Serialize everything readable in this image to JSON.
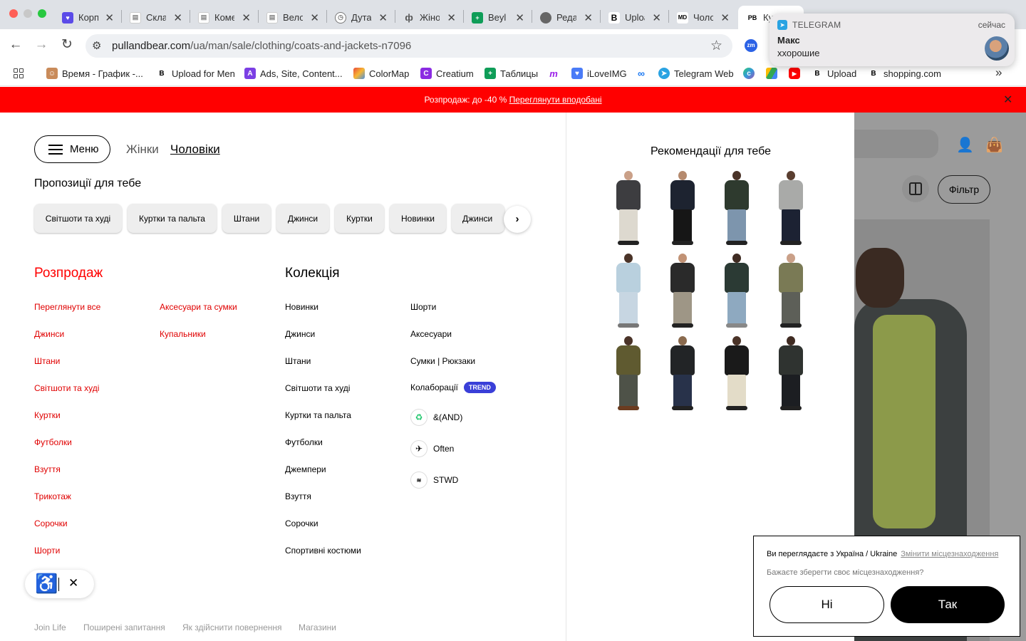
{
  "browser": {
    "tabs": [
      {
        "title": "Корпоративний",
        "fav": "heart-icon",
        "color": "#5b4be8"
      },
      {
        "title": "Склад",
        "fav": "doc-icon",
        "color": "#ffffff"
      },
      {
        "title": "Комерція",
        "fav": "doc-icon",
        "color": "#ffffff"
      },
      {
        "title": "Велосипед",
        "fav": "doc-icon",
        "color": "#ffffff"
      },
      {
        "title": "Дутая куртка",
        "fav": "clock-icon",
        "color": "#ffffff"
      },
      {
        "title": "Жіночий",
        "fav": "tuning-fork-icon",
        "color": "#ffffff"
      },
      {
        "title": "Beyl",
        "fav": "sheets-icon",
        "color": "#0f9d58"
      },
      {
        "title": "Редактор",
        "fav": "globe-icon",
        "color": "#ffffff"
      },
      {
        "title": "Upload",
        "fav": "b-icon",
        "color": "#ffffff"
      },
      {
        "title": "Чоловіки",
        "fav": "md-icon",
        "color": "#ffffff"
      },
      {
        "title": "Куртки",
        "fav": "pb-icon",
        "color": "#ffffff"
      }
    ],
    "url_host": "pullandbear.com",
    "url_path": "/ua/man/sale/clothing/coats-and-jackets-n7096",
    "bookmarks": [
      {
        "label": "Время - График -...",
        "color": "#c98b5a"
      },
      {
        "label": "Upload for Men",
        "color": "#000000"
      },
      {
        "label": "Ads, Site, Content...",
        "color": "#7b3fe4"
      },
      {
        "label": "ColorMap",
        "color": "#e8493b"
      },
      {
        "label": "Creatium",
        "color": "#8b2be2"
      },
      {
        "label": "Таблицы",
        "color": "#0f9d58"
      },
      {
        "label": "iLoveIMG",
        "color": "#4a7bf7"
      },
      {
        "label": "Telegram Web",
        "color": "#2aa3e2"
      },
      {
        "label": "Upload",
        "color": "#000000"
      },
      {
        "label": "shopping.com",
        "color": "#000000"
      }
    ]
  },
  "notification": {
    "app": "TELEGRAM",
    "time": "сейчас",
    "sender": "Макс",
    "message": "ххорошие"
  },
  "promo": {
    "text": "Розпродаж: до -40 % ",
    "link": "Переглянути вподобані"
  },
  "menu": {
    "menu_label": "Меню",
    "women": "Жінки",
    "men": "Чоловіки",
    "suggestions_title": "Пропозиції для тебе",
    "chips": [
      "Світшоти та худі",
      "Куртки та пальта",
      "Штани",
      "Джинси",
      "Куртки",
      "Новинки",
      "Джинси"
    ],
    "sale_title": "Розпродаж",
    "sale_col1": [
      "Переглянути все",
      "Джинси",
      "Штани",
      "Світшоти та худі",
      "Куртки",
      "Футболки",
      "Взуття",
      "Трикотаж",
      "Сорочки",
      "Шорти"
    ],
    "sale_col2": [
      "Аксесуари та сумки",
      "Купальники"
    ],
    "collection_title": "Колекція",
    "coll_col1": [
      "Новинки",
      "Джинси",
      "Штани",
      "Світшоти та худі",
      "Куртки та пальта",
      "Футболки",
      "Джемпери",
      "Взуття",
      "Сорочки",
      "Спортивні костюми"
    ],
    "coll_col2": [
      "Шорти",
      "Аксесуари",
      "Сумки | Рюкзаки",
      "Колаборації"
    ],
    "trend_badge": "TREND",
    "brands": [
      "&(AND)",
      "Often",
      "STWD"
    ],
    "footer": [
      "Join Life",
      "Поширені запитання",
      "Як здійснити повернення",
      "Магазини"
    ]
  },
  "recommendations": {
    "title": "Рекомендації для тебе"
  },
  "background_page": {
    "filter_label": "Фільтр"
  },
  "location_dialog": {
    "line1": "Ви переглядаєте з Україна / Ukraine",
    "change_link": "Змінити місцезнаходження",
    "line2": "Бажаєте зберегти своє місцезнаходження?",
    "no": "Ні",
    "yes": "Так"
  }
}
